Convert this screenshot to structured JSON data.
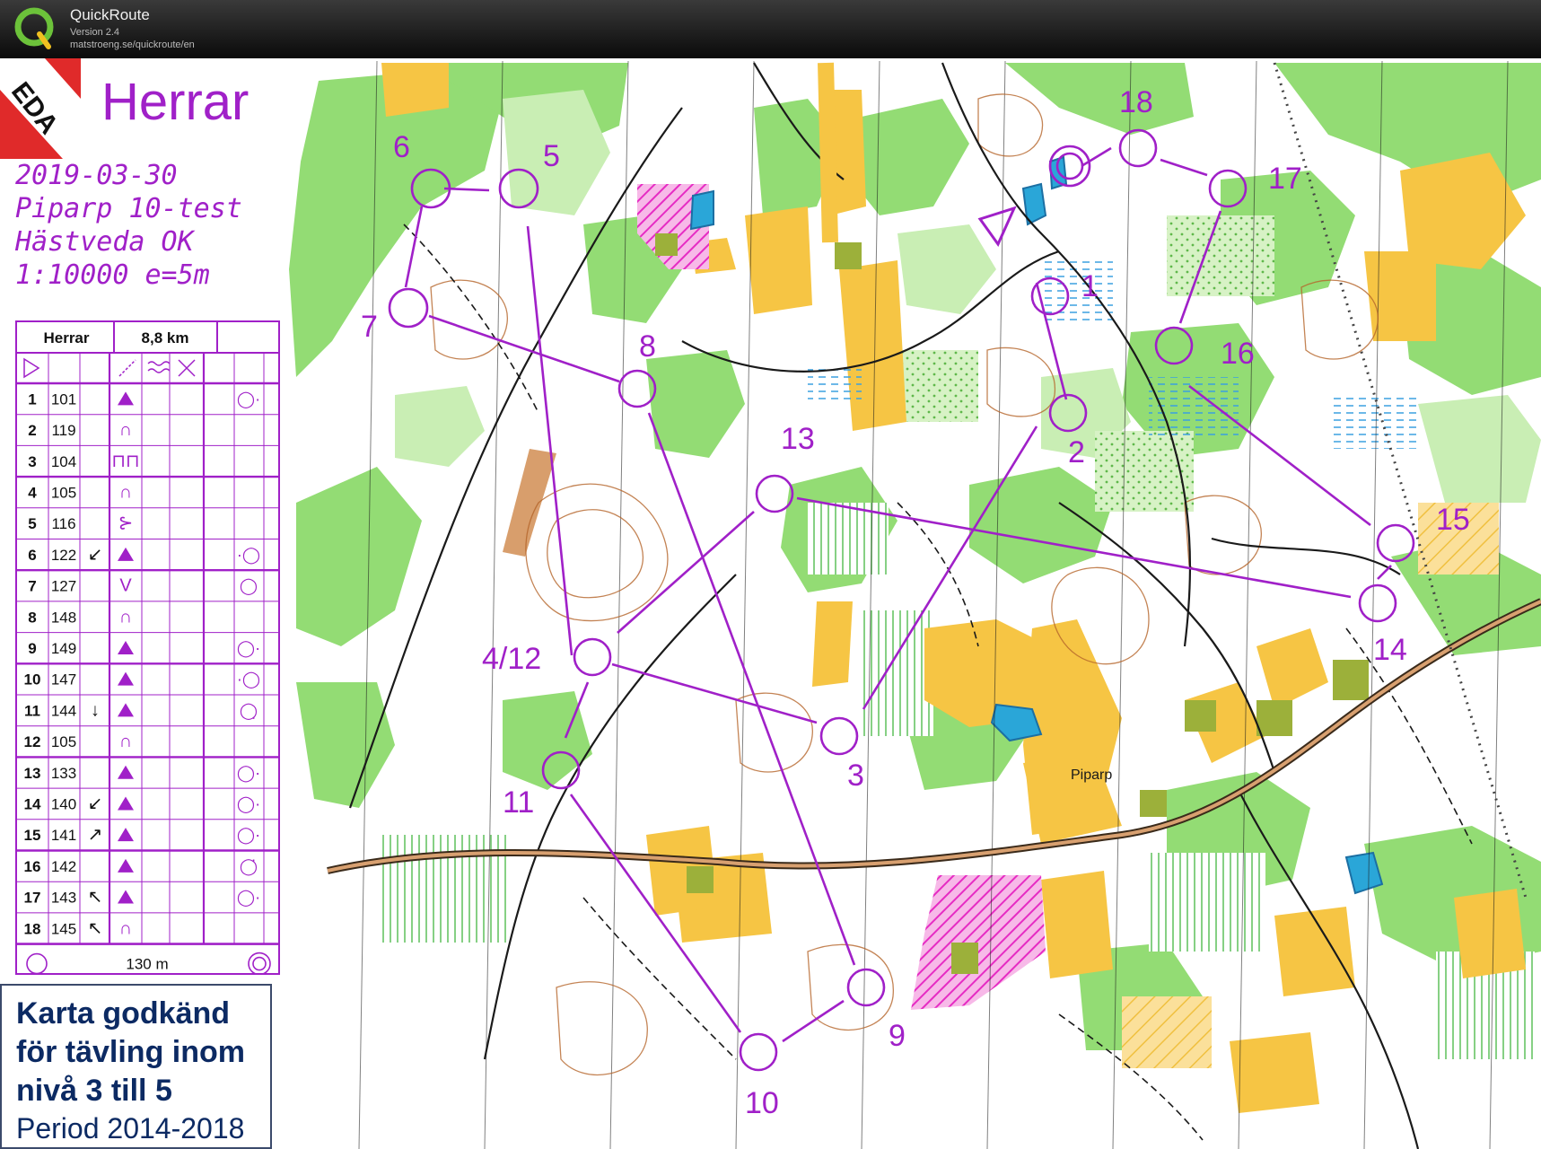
{
  "app": {
    "name": "QuickRoute",
    "version": "Version 2.4",
    "url": "matstroeng.se/quickroute/en"
  },
  "map": {
    "title": "Herrar",
    "date": "2019-03-30",
    "event": "Piparp 10-test",
    "club": "Hästveda OK",
    "scale": "1:10000  e=5m",
    "club_logo_text": "EDA",
    "place_label": "Piparp",
    "approval": [
      "Karta godkänd",
      "för tävling inom",
      "nivå 3 till 5",
      "Period 2014-2018"
    ],
    "control_labels": [
      "1",
      "2",
      "3",
      "4/12",
      "5",
      "6",
      "7",
      "8",
      "9",
      "10",
      "11",
      "13",
      "14",
      "15",
      "16",
      "17",
      "18"
    ]
  },
  "description_sheet": {
    "class": "Herrar",
    "length": "8,8 km",
    "rows": [
      {
        "no": "1",
        "code": "101",
        "dir": "",
        "feature": "▲",
        "detail": "◯·"
      },
      {
        "no": "2",
        "code": "119",
        "dir": "",
        "feature": "∩",
        "detail": ""
      },
      {
        "no": "3",
        "code": "104",
        "dir": "",
        "feature": "⊓⊓",
        "detail": ""
      },
      {
        "no": "4",
        "code": "105",
        "dir": "",
        "feature": "∩",
        "detail": ""
      },
      {
        "no": "5",
        "code": "116",
        "dir": "",
        "feature": "⊱",
        "detail": ""
      },
      {
        "no": "6",
        "code": "122",
        "dir": "↙",
        "feature": "▲",
        "detail": "·◯"
      },
      {
        "no": "7",
        "code": "127",
        "dir": "",
        "feature": "V",
        "detail": "◯"
      },
      {
        "no": "8",
        "code": "148",
        "dir": "",
        "feature": "∩",
        "detail": ""
      },
      {
        "no": "9",
        "code": "149",
        "dir": "",
        "feature": "▲",
        "detail": "◯·"
      },
      {
        "no": "10",
        "code": "147",
        "dir": "",
        "feature": "▲",
        "detail": "·◯"
      },
      {
        "no": "11",
        "code": "144",
        "dir": "↓",
        "feature": "▲",
        "detail": "◯̣"
      },
      {
        "no": "12",
        "code": "105",
        "dir": "",
        "feature": "∩",
        "detail": ""
      },
      {
        "no": "13",
        "code": "133",
        "dir": "",
        "feature": "▲",
        "detail": "◯·"
      },
      {
        "no": "14",
        "code": "140",
        "dir": "↙",
        "feature": "▲",
        "detail": "◯·"
      },
      {
        "no": "15",
        "code": "141",
        "dir": "↗",
        "feature": "▲",
        "detail": "◯·"
      },
      {
        "no": "16",
        "code": "142",
        "dir": "",
        "feature": "▲",
        "detail": "◯̇"
      },
      {
        "no": "17",
        "code": "143",
        "dir": "↖",
        "feature": "▲",
        "detail": "◯·"
      },
      {
        "no": "18",
        "code": "145",
        "dir": "↖",
        "feature": "∩",
        "detail": ""
      }
    ],
    "finish_distance": "130 m"
  },
  "colors": {
    "course": "#a020c8",
    "forest_green": "#8fd86a",
    "light_green": "#c8ecb0",
    "open_yellow": "#f6c544",
    "water_blue": "#2aa6d8",
    "contour_brown": "#b5652a"
  }
}
